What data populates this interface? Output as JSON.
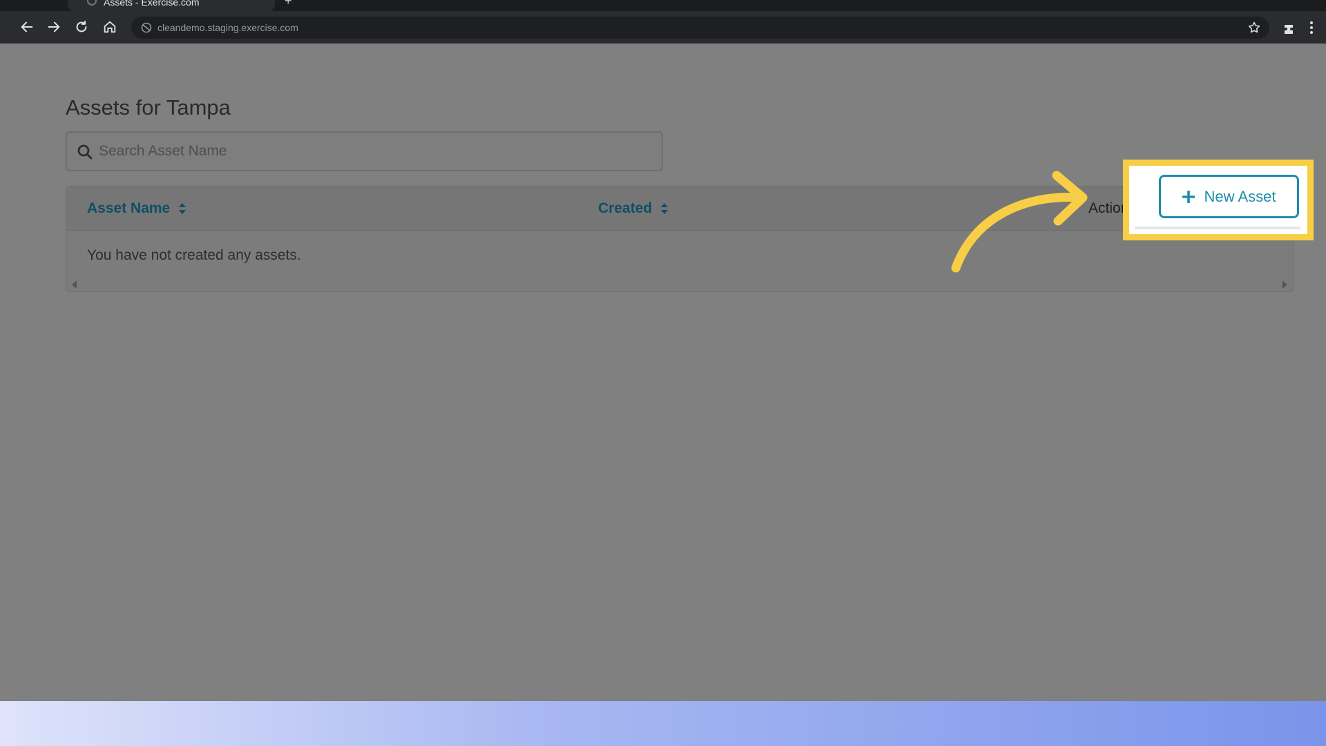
{
  "browser": {
    "tab_title": "Assets - Exercise.com",
    "new_tab_label": "+",
    "url": "cleandemo.staging.exercise.com",
    "icons": [
      "back-arrow-icon",
      "forward-arrow-icon",
      "reload-icon",
      "home-icon",
      "site-info-icon",
      "bookmark-star-icon",
      "extensions-icon",
      "kebab-menu-icon"
    ]
  },
  "page": {
    "title": "Assets for Tampa",
    "search": {
      "placeholder": "Search Asset Name",
      "value": ""
    },
    "new_asset_button": {
      "label": "New Asset",
      "icon": "plus-icon"
    },
    "table": {
      "columns": [
        {
          "label": "Asset Name",
          "sortable": true
        },
        {
          "label": "Created",
          "sortable": true
        },
        {
          "label": "Actions",
          "sortable": false
        }
      ],
      "empty_message": "You have not created any assets."
    }
  },
  "colors": {
    "accent": "#1d8ea9",
    "highlight": "#f7ce45",
    "overlay": "#808080"
  }
}
